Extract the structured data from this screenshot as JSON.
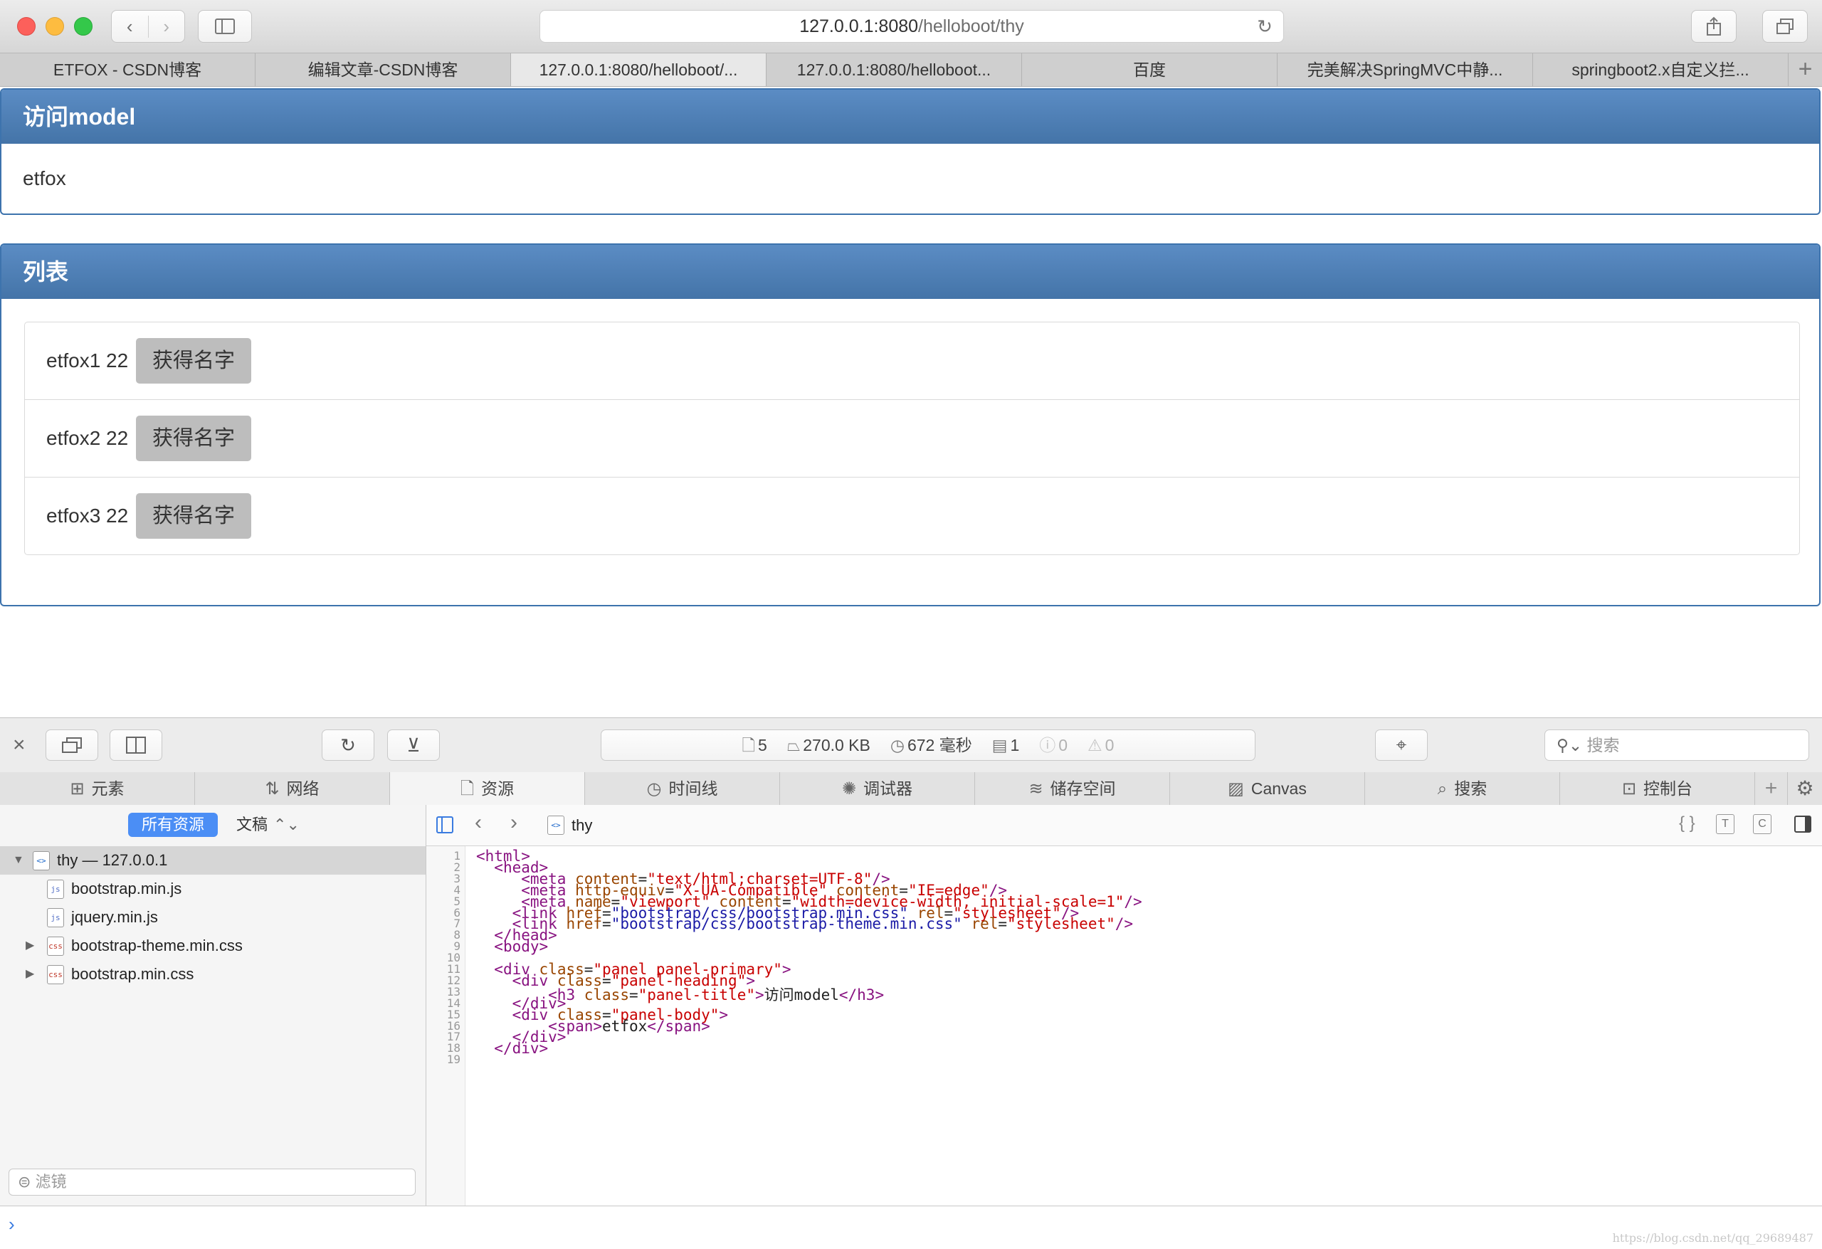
{
  "browser": {
    "url_prefix": "127.0.0.1:8080",
    "url_path": "/helloboot/thy",
    "tabs": [
      {
        "label": "ETFOX - CSDN博客",
        "active": false
      },
      {
        "label": "编辑文章-CSDN博客",
        "active": false
      },
      {
        "label": "127.0.0.1:8080/helloboot/...",
        "active": true
      },
      {
        "label": "127.0.0.1:8080/helloboot...",
        "active": false
      },
      {
        "label": "百度",
        "active": false
      },
      {
        "label": "完美解决SpringMVC中静...",
        "active": false
      },
      {
        "label": "springboot2.x自定义拦..."
      }
    ],
    "new_tab_label": "+"
  },
  "page": {
    "panel1": {
      "title": "访问model",
      "body": "etfox"
    },
    "panel2": {
      "title": "列表",
      "items": [
        {
          "text": "etfox1 22",
          "button": "获得名字"
        },
        {
          "text": "etfox2 22",
          "button": "获得名字"
        },
        {
          "text": "etfox3 22",
          "button": "获得名字"
        }
      ]
    }
  },
  "devtools": {
    "stats": {
      "resources": "5",
      "size": "270.0 KB",
      "time": "672 毫秒",
      "logs": "1",
      "errors": "0",
      "warnings": "0"
    },
    "search_placeholder": "搜索",
    "tabs": [
      {
        "label": "元素",
        "icon": "elements-icon"
      },
      {
        "label": "网络",
        "icon": "network-icon"
      },
      {
        "label": "资源",
        "icon": "resources-icon",
        "active": true
      },
      {
        "label": "时间线",
        "icon": "timeline-icon"
      },
      {
        "label": "调试器",
        "icon": "debugger-icon"
      },
      {
        "label": "储存空间",
        "icon": "storage-icon"
      },
      {
        "label": "Canvas",
        "icon": "canvas-icon"
      },
      {
        "label": "搜索",
        "icon": "search-icon"
      },
      {
        "label": "控制台",
        "icon": "console-icon"
      }
    ],
    "sidebar": {
      "scope_all": "所有资源",
      "scope_doc": "文稿",
      "tree": [
        {
          "label": "thy — 127.0.0.1",
          "type": "html",
          "expanded": true,
          "selected": true
        },
        {
          "label": "bootstrap.min.js",
          "type": "js"
        },
        {
          "label": "jquery.min.js",
          "type": "js"
        },
        {
          "label": "bootstrap-theme.min.css",
          "type": "css",
          "collapsed": true
        },
        {
          "label": "bootstrap.min.css",
          "type": "css",
          "collapsed": true
        }
      ],
      "filter_placeholder": "滤镜"
    },
    "code_nav": {
      "file": "thy"
    },
    "code_lines": [
      "<html>",
      "  <head>",
      "     <meta content=\"text/html;charset=UTF-8\"/>",
      "     <meta http-equiv=\"X-UA-Compatible\" content=\"IE=edge\"/>",
      "     <meta name=\"viewport\" content=\"width=device-width, initial-scale=1\"/>",
      "    <link href=\"bootstrap/css/bootstrap.min.css\" rel=\"stylesheet\"/>",
      "    <link href=\"bootstrap/css/bootstrap-theme.min.css\" rel=\"stylesheet\"/>",
      "  </head>",
      "  <body>",
      "",
      "  <div class=\"panel panel-primary\">",
      "    <div class=\"panel-heading\">",
      "        <h3 class=\"panel-title\">访问model</h3>",
      "    </div>",
      "    <div class=\"panel-body\">",
      "        <span>etfox</span>",
      "    </div>",
      "  </div>",
      ""
    ]
  },
  "watermark": "https://blog.csdn.net/qq_29689487"
}
